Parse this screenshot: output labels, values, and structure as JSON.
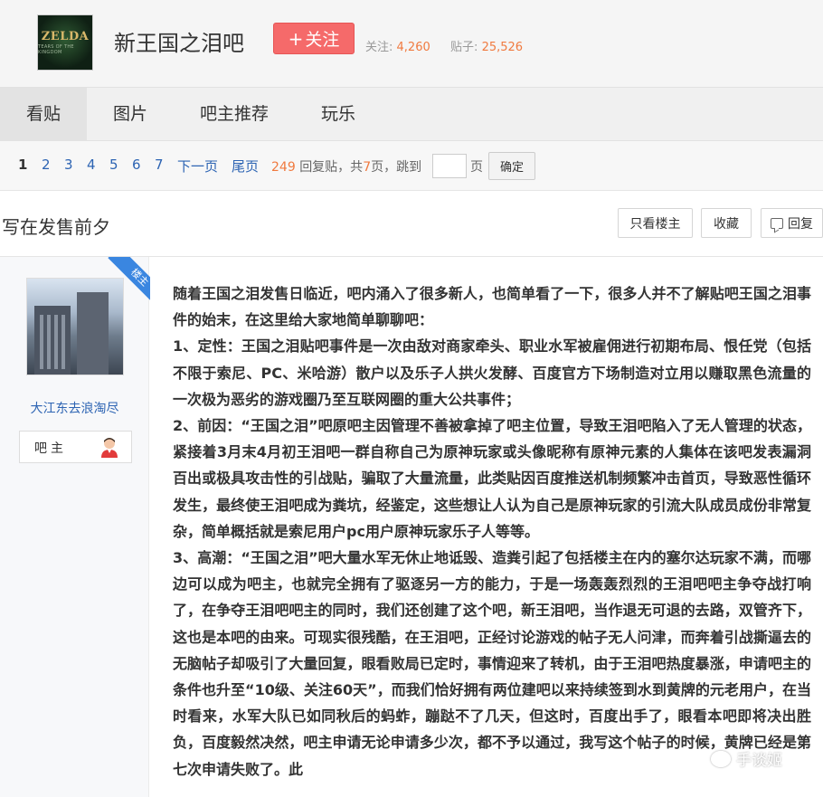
{
  "header": {
    "logo_text": "ZELDA",
    "logo_subtext": "TEARS OF THE KINGDOM",
    "title": "新王国之泪吧",
    "follow_label": "关注",
    "follow_plus": "+",
    "followers_label": "关注:",
    "followers_count": "4,260",
    "posts_label": "贴子:",
    "posts_count": "25,526"
  },
  "nav": {
    "tabs": [
      {
        "label": "看贴",
        "active": true
      },
      {
        "label": "图片",
        "active": false
      },
      {
        "label": "吧主推荐",
        "active": false
      },
      {
        "label": "玩乐",
        "active": false
      }
    ]
  },
  "pager": {
    "pages": [
      "1",
      "2",
      "3",
      "4",
      "5",
      "6",
      "7"
    ],
    "current": "1",
    "next_label": "下一页",
    "last_label": "尾页",
    "reply_count": "249",
    "reply_label": "回复贴，共",
    "page_total": "7",
    "page_total_label": "页，跳到",
    "unit": "页",
    "confirm_label": "确定"
  },
  "thread": {
    "title": "写在发售前夕",
    "only_owner_label": "只看楼主",
    "favorite_label": "收藏",
    "reply_label": "回复"
  },
  "post": {
    "corner_badge": "楼主",
    "username": "大江东去浪淘尽",
    "role": "吧主",
    "paragraphs": [
      "随着王国之泪发售日临近，吧内涌入了很多新人，也简单看了一下，很多人并不了解贴吧王国之泪事件的始末，在这里给大家地简单聊聊吧：",
      "1、定性：王国之泪贴吧事件是一次由敌对商家牵头、职业水军被雇佣进行初期布局、恨任党（包括不限于索尼、PC、米哈游）散户以及乐子人拱火发酵、百度官方下场制造对立用以赚取黑色流量的一次极为恶劣的游戏圈乃至互联网圈的重大公共事件；",
      "2、前因：“王国之泪”吧原吧主因管理不善被拿掉了吧主位置，导致王泪吧陷入了无人管理的状态，紧接着3月末4月初王泪吧一群自称自己为原神玩家或头像昵称有原神元素的人集体在该吧发表漏洞百出或极具攻击性的引战贴，骗取了大量流量，此类贴因百度推送机制频繁冲击首页，导致恶性循环发生，最终使王泪吧成为粪坑，经鉴定，这些想让人认为自己是原神玩家的引流大队成员成份非常复杂，简单概括就是索尼用户pc用户原神玩家乐子人等等。",
      "3、高潮：“王国之泪”吧大量水军无休止地诋毁、造粪引起了包括楼主在内的塞尔达玩家不满，而哪边可以成为吧主，也就完全拥有了驱逐另一方的能力，于是一场轰轰烈烈的王泪吧吧主争夺战打响了，在争夺王泪吧吧主的同时，我们还创建了这个吧，新王泪吧，当作退无可退的去路，双管齐下，这也是本吧的由来。可现实很残酷，在王泪吧，正经讨论游戏的帖子无人问津，而奔着引战撕逼去的无脑帖子却吸引了大量回复，眼看败局已定时，事情迎来了转机，由于王泪吧热度暴涨，申请吧主的条件也升至“10级、关注60天”，而我们恰好拥有两位建吧以来持续签到水到黄牌的元老用户，在当时看来，水军大队已如同秋后的蚂蚱，蹦跶不了几天，但这时，百度出手了，眼看本吧即将决出胜负，百度毅然决然，吧主申请无论申请多少次，都不予以通过，我写这个帖子的时候，黄牌已经是第七次申请失败了。此"
    ]
  },
  "watermark": "手谈姬"
}
